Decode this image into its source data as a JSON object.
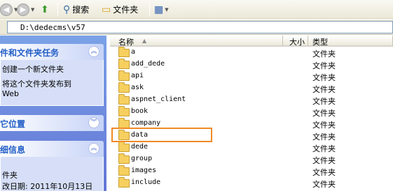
{
  "toolbar": {
    "back_label": "",
    "search_label": "搜索",
    "folders_label": "文件夹",
    "icons": [
      "back-icon",
      "forward-icon",
      "up-folder-icon",
      "search-icon",
      "folders-icon",
      "views-icon"
    ]
  },
  "address": {
    "path": "D:\\dedecms\\v57"
  },
  "task_pane": {
    "file_tasks": {
      "title": "件和文件夹任务",
      "items": [
        "创建一个新文件夹",
        "将这个文件夹发布到",
        "Web"
      ]
    },
    "other_places": {
      "title": "它位置"
    },
    "details": {
      "title": "细信息",
      "lines": [
        "",
        "件夹",
        "改日期: 2011年10月13日"
      ]
    }
  },
  "list": {
    "columns": {
      "name": "名称",
      "size": "大小",
      "type": "类型"
    },
    "sort_indicator": "▲",
    "rows": [
      {
        "name": "a",
        "type": "文件夹"
      },
      {
        "name": "add_dede",
        "type": "文件夹"
      },
      {
        "name": "api",
        "type": "文件夹"
      },
      {
        "name": "ask",
        "type": "文件夹"
      },
      {
        "name": "aspnet_client",
        "type": "文件夹"
      },
      {
        "name": "book",
        "type": "文件夹"
      },
      {
        "name": "company",
        "type": "文件夹"
      },
      {
        "name": "data",
        "type": "文件夹"
      },
      {
        "name": "dede",
        "type": "文件夹"
      },
      {
        "name": "group",
        "type": "文件夹"
      },
      {
        "name": "images",
        "type": "文件夹"
      },
      {
        "name": "include",
        "type": "文件夹"
      }
    ],
    "highlighted_row": "data"
  },
  "colors": {
    "highlight": "#f08a24",
    "task_pane": "#6f8ee0",
    "folder": "#f6cf5f"
  }
}
